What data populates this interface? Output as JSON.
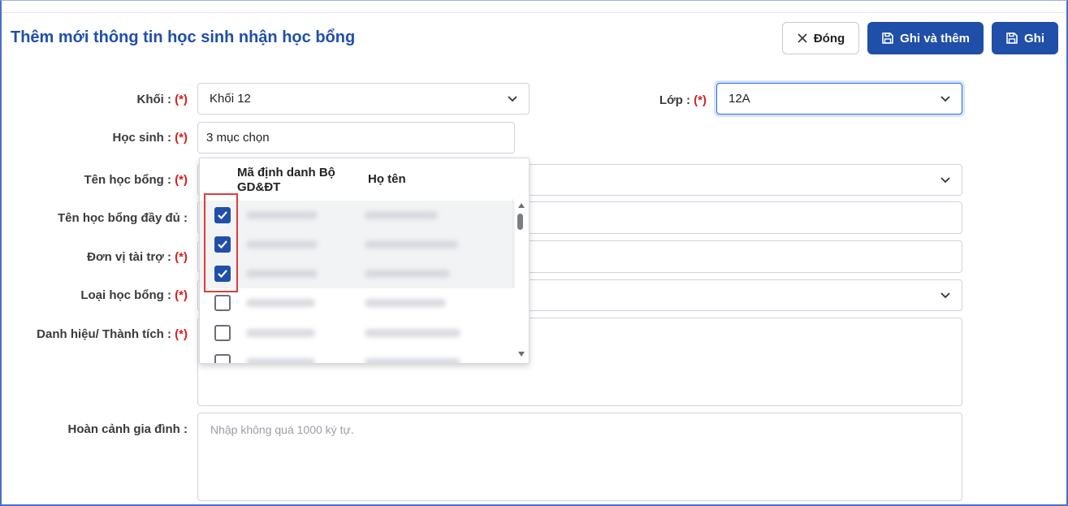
{
  "page": {
    "title": "Thêm mới thông tin học sinh nhận học bổng"
  },
  "toolbar": {
    "close_label": "Đóng",
    "save_add_label": "Ghi và thêm",
    "save_label": "Ghi"
  },
  "form": {
    "required_mark": "(*)",
    "khoi": {
      "label": "Khối :",
      "value": "Khối 12"
    },
    "lop": {
      "label": "Lớp :",
      "value": "12A"
    },
    "hoc_sinh": {
      "label": "Học sinh :",
      "value": "3 mục chọn"
    },
    "ten_hoc_bong": {
      "label": "Tên học bổng :"
    },
    "ten_hoc_bong_day_du": {
      "label": "Tên học bổng đầy đủ :"
    },
    "don_vi_tai_tro": {
      "label": "Đơn vị tài trợ :"
    },
    "loai_hoc_bong": {
      "label": "Loại học bổng :"
    },
    "danh_hieu": {
      "label": "Danh hiệu/ Thành tích :"
    },
    "hoan_canh": {
      "label": "Hoàn cảnh gia đình :",
      "placeholder": "Nhập không quá 1000 ký tự."
    }
  },
  "dropdown": {
    "columns": [
      "Mã định danh Bộ GD&ĐT",
      "Họ tên"
    ],
    "rows": [
      {
        "checked": true
      },
      {
        "checked": true
      },
      {
        "checked": true
      },
      {
        "checked": false
      },
      {
        "checked": false
      },
      {
        "checked": false
      }
    ]
  },
  "colors": {
    "primary": "#1f4fa8",
    "required": "#d71f1f",
    "highlight": "#e03a3a"
  }
}
